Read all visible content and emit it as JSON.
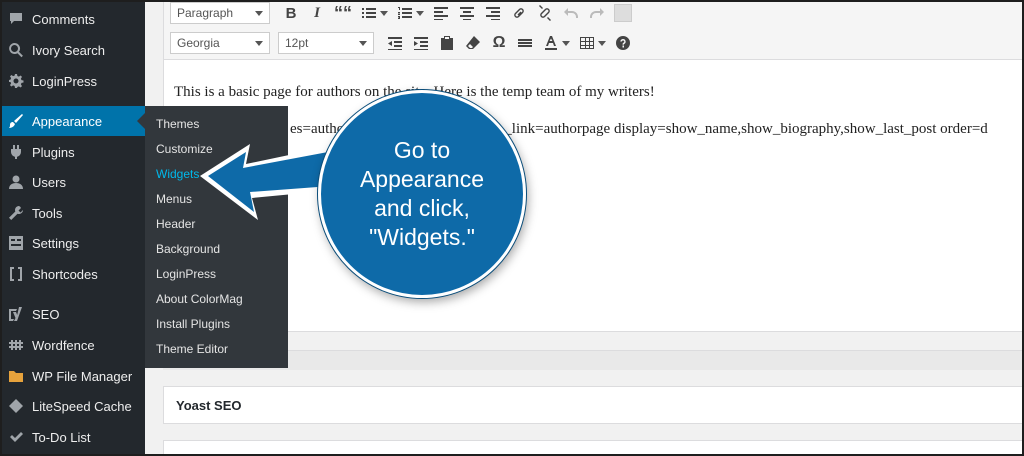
{
  "sidebar": {
    "items": [
      {
        "label": "Comments",
        "icon": "comment-icon"
      },
      {
        "label": "Ivory Search",
        "icon": "search-icon"
      },
      {
        "label": "LoginPress",
        "icon": "gear-icon"
      },
      {
        "label": "Appearance",
        "icon": "paintbrush-icon",
        "active": true
      },
      {
        "label": "Plugins",
        "icon": "plugin-icon"
      },
      {
        "label": "Users",
        "icon": "user-icon"
      },
      {
        "label": "Tools",
        "icon": "wrench-icon"
      },
      {
        "label": "Settings",
        "icon": "settings-icon"
      },
      {
        "label": "Shortcodes",
        "icon": "brackets-icon"
      },
      {
        "label": "SEO",
        "icon": "yoast-icon"
      },
      {
        "label": "Wordfence",
        "icon": "wordfence-icon"
      },
      {
        "label": "WP File Manager",
        "icon": "folder-icon"
      },
      {
        "label": "LiteSpeed Cache",
        "icon": "diamond-icon"
      },
      {
        "label": "To-Do List",
        "icon": "check-icon"
      }
    ]
  },
  "flyout": {
    "items": [
      {
        "label": "Themes"
      },
      {
        "label": "Customize"
      },
      {
        "label": "Widgets",
        "current": true
      },
      {
        "label": "Menus"
      },
      {
        "label": "Header"
      },
      {
        "label": "Background"
      },
      {
        "label": "LoginPress"
      },
      {
        "label": "About ColorMag"
      },
      {
        "label": "Install Plugins"
      },
      {
        "label": "Theme Editor"
      }
    ]
  },
  "toolbar": {
    "format_select": "Paragraph",
    "font_select": "Georgia",
    "size_select": "12pt",
    "bold": "B",
    "italic": "I",
    "quote": "““",
    "omega": "Ω"
  },
  "content": {
    "line1": "This is a basic page for authors on the site. Here is the temp team of my writers!",
    "line2": "[...]es=autho[...]_link=authorpage display=show_name,show_biography,show_last_post order=d",
    "line2_left": "es=autho",
    "line2_right": "_link=authorpage display=show_name,show_biography,show_last_post order=d"
  },
  "panels": {
    "yoast": "Yoast SEO"
  },
  "callout": {
    "text": "Go to\nAppearance\nand click,\n\"Widgets.\""
  },
  "colors": {
    "sidebar_bg": "#23282d",
    "active_bg": "#0073aa",
    "flyout_bg": "#32373c",
    "current_link": "#00b9eb",
    "callout_bg": "#0e6aa8"
  }
}
